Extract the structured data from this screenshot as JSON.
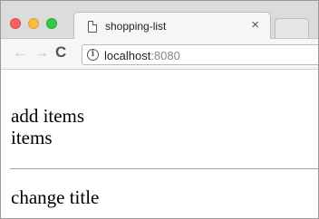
{
  "browser": {
    "tab": {
      "title": "shopping-list",
      "close_glyph": "×"
    },
    "nav": {
      "back_glyph": "←",
      "forward_glyph": "→",
      "reload_glyph": "C"
    },
    "address": {
      "info_glyph": "i",
      "host": "localhost",
      "port": ":8080"
    },
    "colors": {
      "close": "#fc605c",
      "minimize": "#fdbc40",
      "maximize": "#34c84a"
    }
  },
  "page": {
    "add_items": "add items",
    "items": "items",
    "change_title": "change title"
  }
}
